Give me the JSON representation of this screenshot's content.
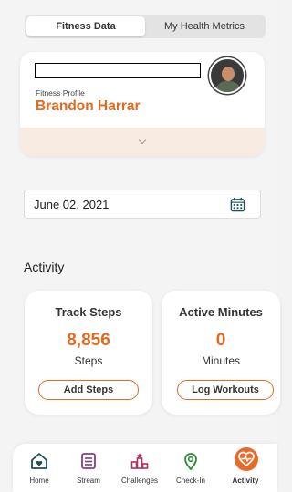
{
  "tabs": [
    {
      "label": "Fitness Data",
      "active": true
    },
    {
      "label": "My Health Metrics",
      "active": false
    }
  ],
  "profile": {
    "subtitle": "Fitness Profile",
    "name": "Brandon Harrar"
  },
  "date": {
    "value": "June 02, 2021",
    "icon": "calendar-icon"
  },
  "activity": {
    "title": "Activity",
    "cards": [
      {
        "title": "Track Steps",
        "value": "8,856",
        "unit": "Steps",
        "button": "Add Steps"
      },
      {
        "title": "Active Minutes",
        "value": "0",
        "unit": "Minutes",
        "button": "Log Workouts"
      }
    ]
  },
  "nav": [
    {
      "label": "Home",
      "icon": "home-icon",
      "color": "#1f4f5a"
    },
    {
      "label": "Stream",
      "icon": "stream-icon",
      "color": "#8a3a8a"
    },
    {
      "label": "Challenges",
      "icon": "challenges-icon",
      "color": "#b0325a"
    },
    {
      "label": "Check-In",
      "icon": "check-in-icon",
      "color": "#2e8b3a"
    },
    {
      "label": "Activity",
      "icon": "activity-icon",
      "color": "#e86a2a",
      "active": true
    }
  ],
  "colors": {
    "accent": "#e06a1e",
    "profile_footer": "#f8ebe2"
  }
}
